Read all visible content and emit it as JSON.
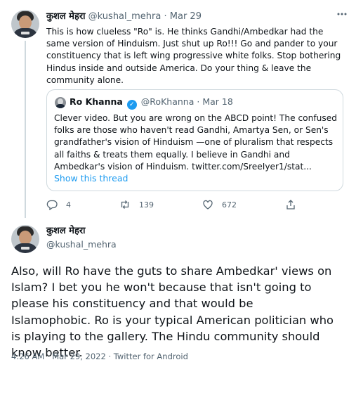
{
  "tweet1": {
    "author_name": "कुशल मेहरा",
    "author_handle": "@kushal_mehra",
    "separator": "·",
    "date": "Mar 29",
    "more_icon": "more-horizontal-icon",
    "text": "This is how clueless \"Ro\" is. He thinks Gandhi/Ambedkar had the same version of Hinduism. Just shut up Ro!!! Go and pander to your constituency that is left wing progressive white folks. Stop bothering Hindus inside and outside America. Do your thing & leave the community alone.",
    "quote": {
      "author_name": "Ro Khanna",
      "verified_icon": "verified-badge-icon",
      "author_handle": "@RoKhanna",
      "separator": "·",
      "date": "Mar 18",
      "text": "Clever video. But you are wrong on the ABCD point! The confused folks are those who haven't read Gandhi, Amartya Sen, or Sen's grandfather's vision of Hinduism —one of pluralism that respects all faiths & treats them equally. I believe in Gandhi and Ambedkar's vision of Hinduism. twitter.com/SreeIyer1/stat...",
      "show_thread": "Show this thread"
    },
    "actions": {
      "reply_count": "4",
      "retweet_count": "139",
      "like_count": "672",
      "icons": [
        "reply-icon",
        "retweet-icon",
        "like-icon",
        "share-icon"
      ]
    }
  },
  "tweet2": {
    "author_name": "कुशल मेहरा",
    "author_handle": "@kushal_mehra",
    "text": "Also, will Ro have the guts to share Ambedkar' views on Islam? I bet you he won't because that isn't going to please his constituency and that would be Islamophobic. Ro is your typical American politician who is playing to the gallery. The Hindu community should know better.",
    "meta": "4:26 AM · Mar 29, 2022 · Twitter for Android"
  },
  "colors": {
    "text": "#0f1419",
    "secondary": "#536471",
    "accent": "#1d9bf0",
    "border": "#cfd9de"
  }
}
